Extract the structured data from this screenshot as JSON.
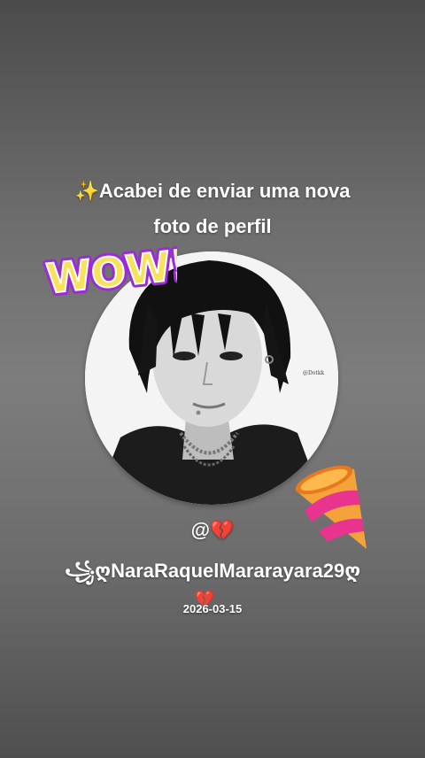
{
  "post": {
    "headline_line1": "✨Acabei de enviar uma nova",
    "headline_line2": "foto de perfil",
    "mention_prefix": "@💔",
    "username": "꧁ღNaraRaquelMararayara29ღ",
    "trailing_emoji": "💔",
    "date": "2026-03-15"
  },
  "avatar": {
    "watermark": "@Dotkk"
  },
  "stickers": {
    "wow_text": "WOW!",
    "party_icon": "party-popper"
  },
  "colors": {
    "background": "#6e6e6e",
    "wow_fill": "#f7e35a",
    "wow_outline": "#9b2bd6",
    "popper_orange": "#f4a23a",
    "popper_pink": "#e8338f"
  }
}
